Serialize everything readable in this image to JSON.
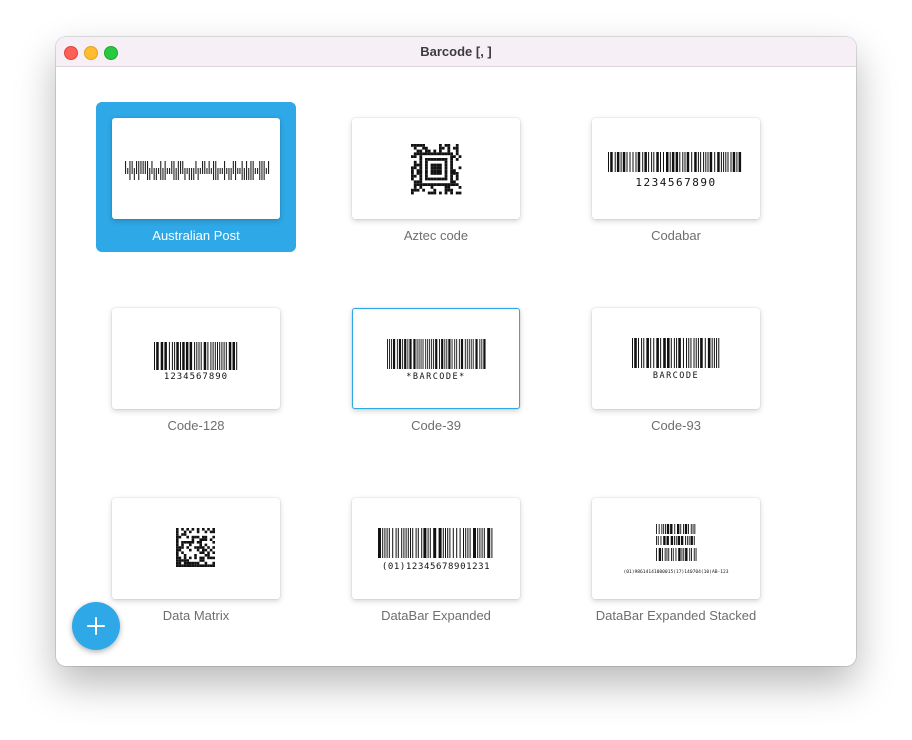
{
  "window": {
    "title": "Barcode [, ]"
  },
  "tiles": [
    {
      "label": "Australian Post",
      "icon": "australian-post-barcode",
      "selected": true
    },
    {
      "label": "Aztec code",
      "icon": "aztec-code-symbol"
    },
    {
      "label": "Codabar",
      "icon": "codabar-barcode",
      "text": "1234567890"
    },
    {
      "label": "Code-128",
      "icon": "code-128-barcode",
      "text": "1234567890"
    },
    {
      "label": "Code-39",
      "icon": "code-39-barcode",
      "text": "*BARCODE*",
      "focused": true
    },
    {
      "label": "Code-93",
      "icon": "code-93-barcode",
      "text": "BARCODE"
    },
    {
      "label": "Data Matrix",
      "icon": "data-matrix-symbol"
    },
    {
      "label": "DataBar Expanded",
      "icon": "databar-expanded-barcode",
      "text": "(01)12345678901231"
    },
    {
      "label": "DataBar Expanded Stacked",
      "icon": "databar-expanded-stacked-barcode",
      "text": "(01)98614141000015(17)140704(10)AB-123"
    }
  ],
  "fab": {
    "icon": "plus-icon"
  },
  "colors": {
    "accent": "#2ea8e6",
    "titlebar": "#f6f0f6",
    "label": "#6e6e73"
  }
}
